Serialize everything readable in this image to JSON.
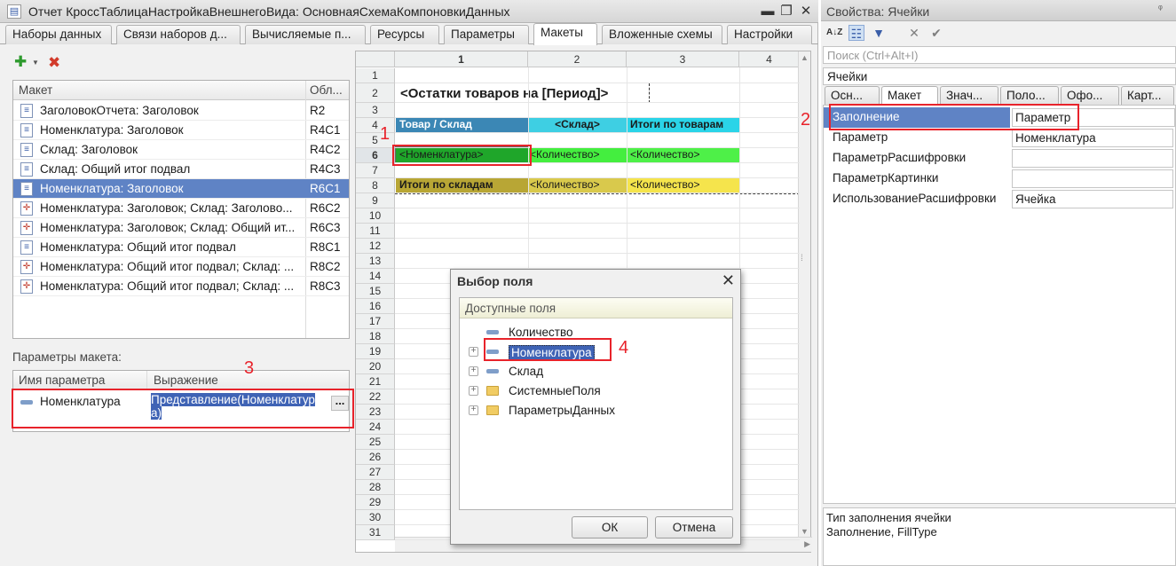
{
  "window": {
    "title": "Отчет КроссТаблицаНастройкаВнешнегоВида: ОсновнаяСхемаКомпоновкиДанных",
    "tabs": [
      "Наборы данных",
      "Связи наборов д...",
      "Вычисляемые п...",
      "Ресурсы",
      "Параметры",
      "Макеты",
      "Вложенные схемы",
      "Настройки"
    ],
    "active_tab": "Макеты"
  },
  "layouts": {
    "headers": [
      "Макет",
      "Обл..."
    ],
    "rows": [
      {
        "name": "ЗаголовокОтчета: Заголовок",
        "area": "R2"
      },
      {
        "name": "Номенклатура: Заголовок",
        "area": "R4C1"
      },
      {
        "name": "Склад: Заголовок",
        "area": "R4C2"
      },
      {
        "name": "Склад: Общий итог подвал",
        "area": "R4C3"
      },
      {
        "name": "Номенклатура: Заголовок",
        "area": "R6C1"
      },
      {
        "name": "Номенклатура: Заголовок; Склад: Заголово...",
        "area": "R6C2"
      },
      {
        "name": "Номенклатура: Заголовок; Склад: Общий ит...",
        "area": "R6C3"
      },
      {
        "name": "Номенклатура: Общий итог подвал",
        "area": "R8C1"
      },
      {
        "name": "Номенклатура: Общий итог подвал; Склад: ...",
        "area": "R8C2"
      },
      {
        "name": "Номенклатура: Общий итог подвал; Склад: ...",
        "area": "R8C3"
      }
    ],
    "selected_index": 4
  },
  "params": {
    "label": "Параметры макета:",
    "headers": [
      "Имя параметра",
      "Выражение"
    ],
    "row": {
      "name": "Номенклатура",
      "expr_line1": "Представление(Номенклатур",
      "expr_line2": "а)",
      "more": "..."
    }
  },
  "sheet": {
    "columns": [
      "1",
      "2",
      "3",
      "4"
    ],
    "rows": [
      "1",
      "2",
      "3",
      "4",
      "5",
      "6",
      "7",
      "8",
      "9",
      "10",
      "11",
      "12",
      "13",
      "14",
      "15",
      "16",
      "17",
      "18",
      "19",
      "20",
      "21",
      "22",
      "23",
      "24",
      "25",
      "26",
      "27",
      "28",
      "29",
      "30",
      "31"
    ],
    "title": "<Остатки товаров на [Период]>",
    "r4": [
      "Товар / Склад",
      "<Склад>",
      "Итоги по товарам"
    ],
    "r6": [
      "<Номенклатура>",
      "<Количество>",
      "<Количество>"
    ],
    "r8": [
      "Итоги по складам",
      "<Количество>",
      "<Количество>"
    ],
    "colors": {
      "r4c1": "#3b87b5",
      "r4c2": "#3ecfe3",
      "r4c3": "#2ad4e8",
      "r6c1": "#1fa62a",
      "r6c2": "#44ee3f",
      "r6c3": "#4ef048",
      "r8c1": "#b8a635",
      "r8c2": "#d9c94c",
      "r8c3": "#f5e44c"
    }
  },
  "dialog": {
    "title": "Выбор поля",
    "tree_header": "Доступные поля",
    "items": [
      {
        "label": "Количество",
        "kind": "field",
        "expandable": false
      },
      {
        "label": "Номенклатура",
        "kind": "field",
        "expandable": true,
        "selected": true
      },
      {
        "label": "Склад",
        "kind": "field",
        "expandable": true
      },
      {
        "label": "СистемныеПоля",
        "kind": "folder",
        "expandable": true
      },
      {
        "label": "ПараметрыДанных",
        "kind": "folder",
        "expandable": true
      }
    ],
    "ok": "ОК",
    "cancel": "Отмена"
  },
  "properties": {
    "title": "Свойства: Ячейки",
    "search_placeholder": "Поиск (Ctrl+Alt+I)",
    "object": "Ячейки",
    "tabs": [
      "Осн...",
      "Макет",
      "Знач...",
      "Поло...",
      "Офо...",
      "Карт..."
    ],
    "active_tab": "Макет",
    "rows": [
      {
        "key": "Заполнение",
        "value": "Параметр"
      },
      {
        "key": "Параметр",
        "value": "Номенклатура"
      },
      {
        "key": "ПараметрРасшифровки",
        "value": ""
      },
      {
        "key": "ПараметрКартинки",
        "value": ""
      },
      {
        "key": "ИспользованиеРасшифровки",
        "value": "Ячейка"
      }
    ],
    "desc_line1": "Тип заполнения ячейки",
    "desc_line2": "Заполнение, FillType"
  },
  "annotations": [
    "1",
    "2",
    "3",
    "4"
  ]
}
